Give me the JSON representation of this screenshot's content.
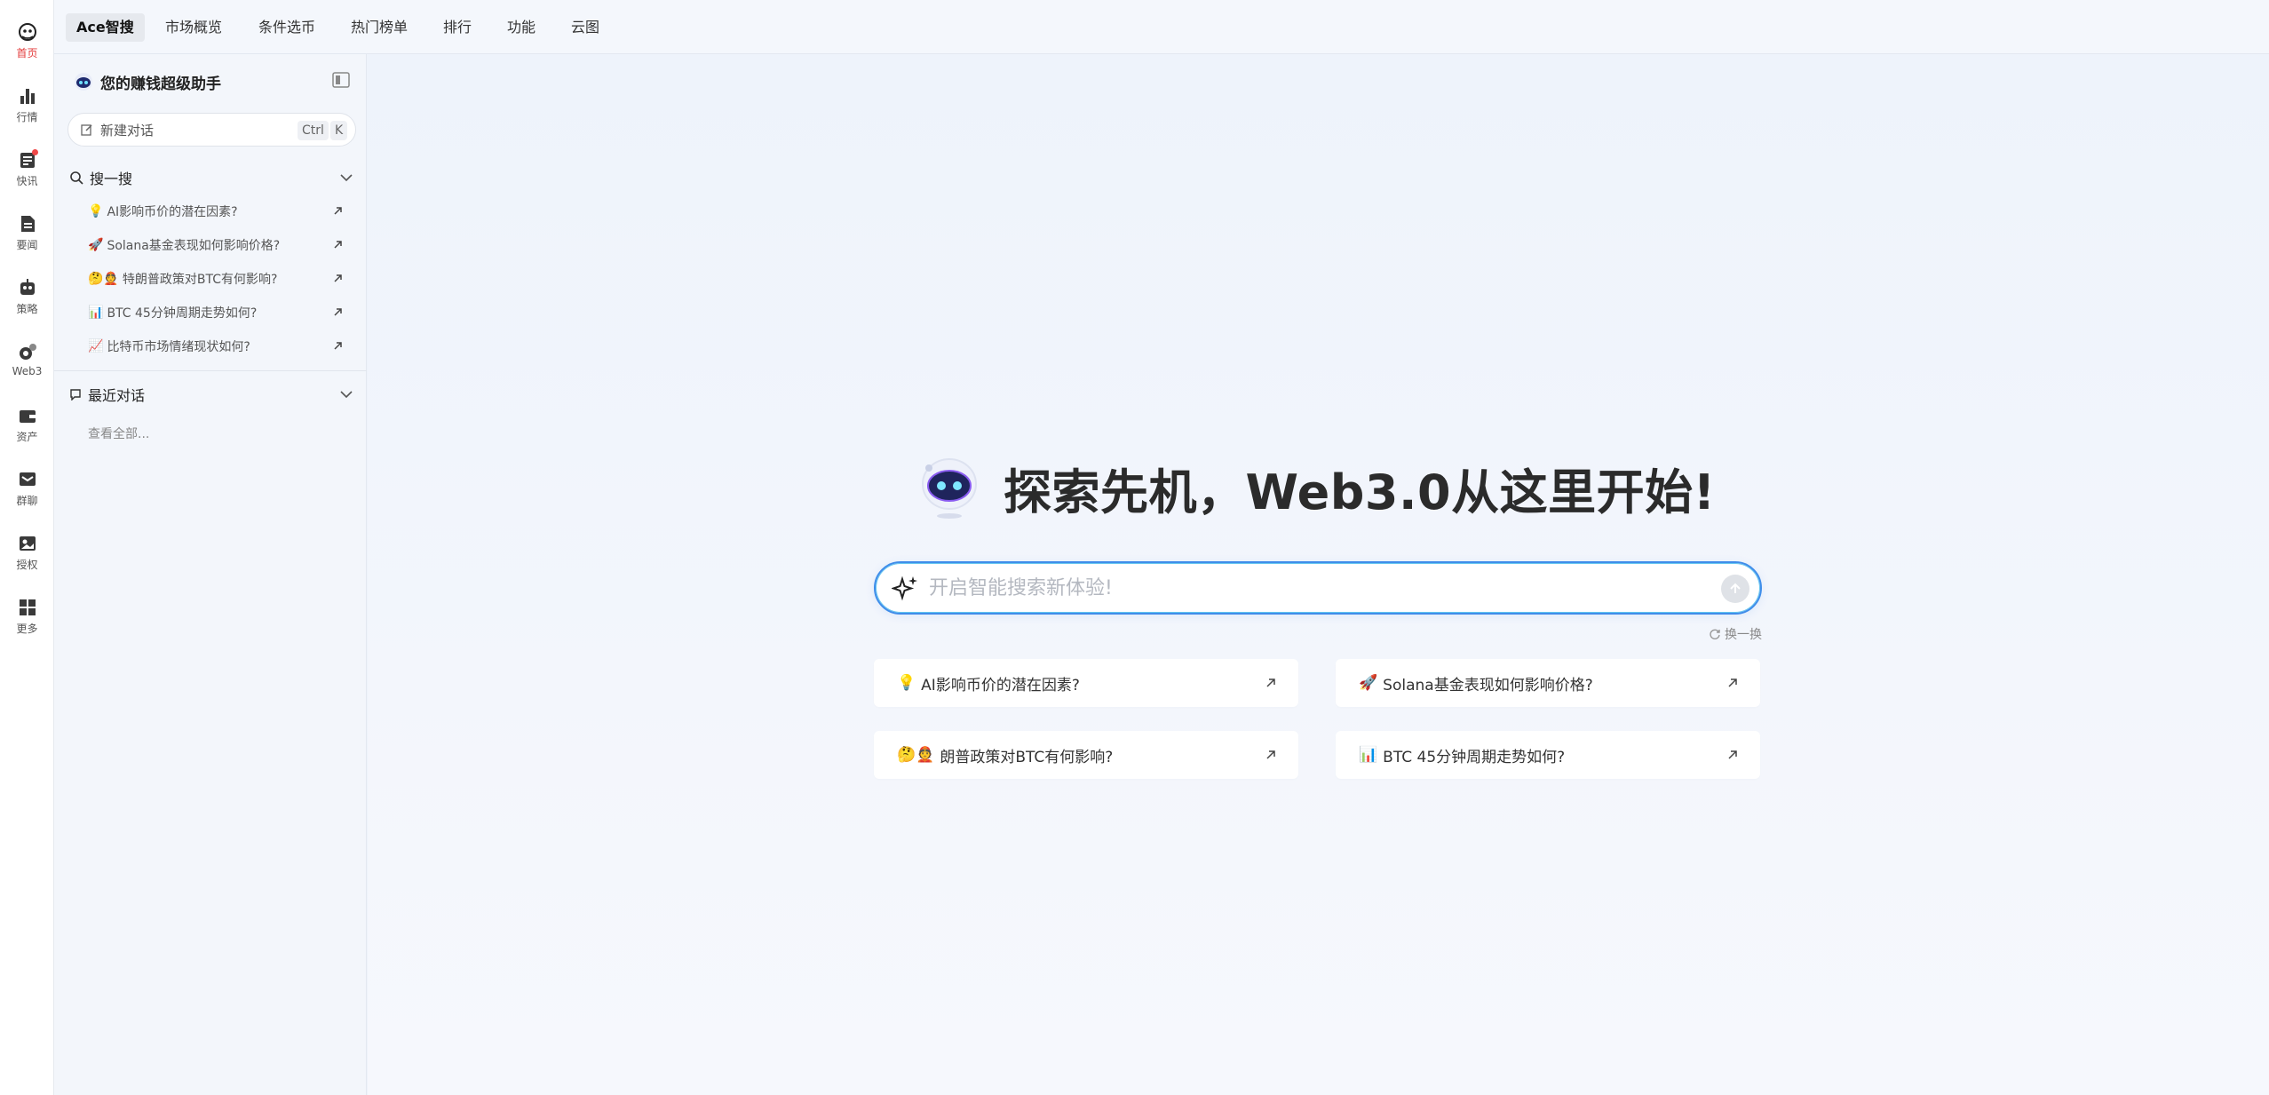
{
  "rail": {
    "items": [
      {
        "label": "首页",
        "icon": "home-ai-icon",
        "active": true
      },
      {
        "label": "行情",
        "icon": "bar-chart-icon"
      },
      {
        "label": "快讯",
        "icon": "news-flash-icon",
        "badge": true
      },
      {
        "label": "要闻",
        "icon": "document-icon"
      },
      {
        "label": "策略",
        "icon": "robot-icon"
      },
      {
        "label": "Web3",
        "icon": "web3-icon"
      },
      {
        "label": "资产",
        "icon": "wallet-icon"
      },
      {
        "label": "群聊",
        "icon": "group-chat-icon"
      },
      {
        "label": "授权",
        "icon": "authorize-icon"
      },
      {
        "label": "更多",
        "icon": "grid-more-icon"
      }
    ]
  },
  "topnav": {
    "tabs": [
      {
        "label": "Ace智搜",
        "active": true
      },
      {
        "label": "市场概览"
      },
      {
        "label": "条件选币"
      },
      {
        "label": "热门榜单"
      },
      {
        "label": "排行"
      },
      {
        "label": "功能"
      },
      {
        "label": "云图"
      }
    ]
  },
  "sidebar": {
    "title": "您的赚钱超级助手",
    "new_chat": {
      "label": "新建对话",
      "key1": "Ctrl",
      "key2": "K"
    },
    "search_section": {
      "label": "搜一搜"
    },
    "questions": [
      {
        "emoji": "💡",
        "text": "AI影响币价的潜在因素?"
      },
      {
        "emoji": "🚀",
        "text": "Solana基金表现如何影响价格?"
      },
      {
        "emoji": "🤔👲",
        "text": "特朗普政策对BTC有何影响?"
      },
      {
        "emoji": "📊",
        "text": "BTC 45分钟周期走势如何?"
      },
      {
        "emoji": "📈",
        "text": "比特币市场情绪现状如何?"
      }
    ],
    "recent_section": {
      "label": "最近对话"
    },
    "view_all": "查看全部..."
  },
  "main": {
    "hero_title": "探索先机，Web3.0从这里开始!",
    "search": {
      "placeholder": "开启智能搜索新体验!",
      "value": ""
    },
    "refresh_label": "换一换",
    "suggestions": [
      {
        "emoji": "💡",
        "text": "AI影响币价的潜在因素?"
      },
      {
        "emoji": "🚀",
        "text": "Solana基金表现如何影响价格?"
      },
      {
        "emoji": "🤔👲",
        "text": "朗普政策对BTC有何影响?"
      },
      {
        "emoji": "📊",
        "text": "BTC 45分钟周期走势如何?"
      }
    ]
  },
  "colors": {
    "accent": "#3f8dea",
    "active_red": "#e33b3b",
    "badge": "#f04848"
  }
}
